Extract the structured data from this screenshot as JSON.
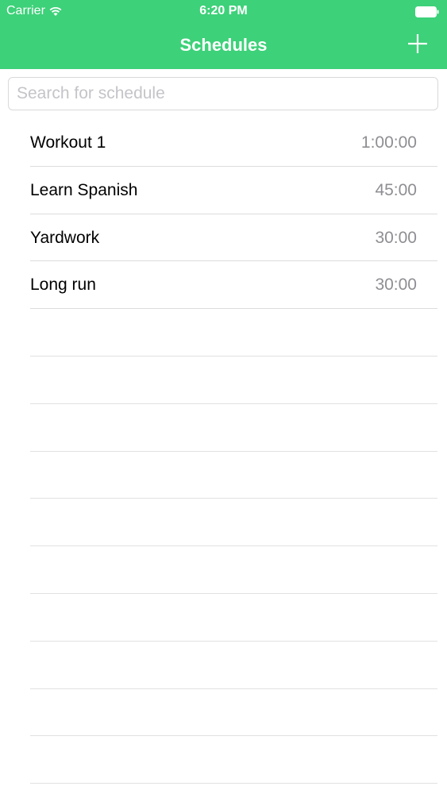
{
  "status_bar": {
    "carrier": "Carrier",
    "time": "6:20 PM",
    "wifi_icon": "wifi-icon",
    "battery_icon": "battery-icon"
  },
  "nav": {
    "title": "Schedules",
    "add_icon": "plus-icon"
  },
  "colors": {
    "accent": "#3dd179",
    "secondary_text": "#8e8e93"
  },
  "search": {
    "placeholder": "Search for schedule",
    "value": ""
  },
  "schedules": [
    {
      "name": "Workout 1",
      "duration": "1:00:00"
    },
    {
      "name": "Learn Spanish",
      "duration": "45:00"
    },
    {
      "name": "Yardwork",
      "duration": "30:00"
    },
    {
      "name": "Long run",
      "duration": "30:00"
    }
  ]
}
